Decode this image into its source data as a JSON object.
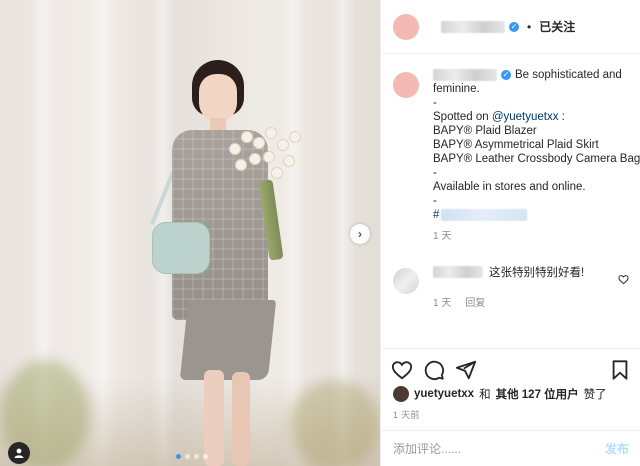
{
  "post": {
    "follow_label": "已关注",
    "separator": "•",
    "verified_icon": "verified-badge-icon",
    "caption_lines": [
      "Be sophisticated and",
      "feminine.",
      "-",
      "Spotted on ",
      "BAPY® Plaid Blazer",
      "BAPY® Asymmetrical Plaid Skirt",
      "BAPY® Leather Crossbody Camera Bag",
      "-",
      "Available in stores and online.",
      "-",
      "#"
    ],
    "mention": "@yuetyuetxx",
    "mention_suffix": " :",
    "caption_time": "1 天",
    "comment": {
      "text": "这张特别特别好看!",
      "time": "1 天",
      "reply": "回复"
    },
    "likes": {
      "user": "yuetyuetxx",
      "and": "和",
      "others": "其他 127 位用户",
      "suffix": "赞了"
    },
    "posted_ago": "1 天前",
    "add_comment_placeholder": "添加评论......",
    "post_button": "发布"
  },
  "colors": {
    "accent": "#3897f0",
    "avatar": "#f4b9b2",
    "post_disabled": "#b2dffc"
  },
  "carousel": {
    "total": 4,
    "active": 1
  }
}
